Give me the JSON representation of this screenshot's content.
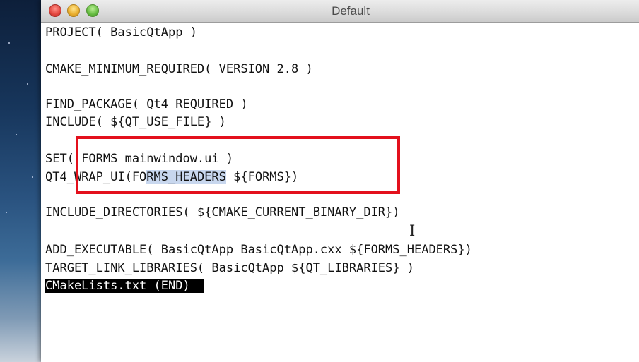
{
  "window": {
    "title": "Default"
  },
  "editor": {
    "lines": [
      "PROJECT( BasicQtApp )",
      "CMAKE_MINIMUM_REQUIRED( VERSION 2.8 )",
      "FIND_PACKAGE( Qt4 REQUIRED )",
      "INCLUDE( ${QT_USE_FILE} )",
      "SET( FORMS mainwindow.ui )",
      "QT4_WRAP_UI(FO",
      "RMS_HEADERS",
      " ${FORMS})",
      "INCLUDE_DIRECTORIES( ${CMAKE_CURRENT_BINARY_DIR})",
      "ADD_EXECUTABLE( BasicQtApp BasicQtApp.cxx ${FORMS_HEADERS})",
      "TARGET_LINK_LIBRARIES( BasicQtApp ${QT_LIBRARIES} )"
    ],
    "status": "CMakeLists.txt (END)"
  },
  "colors": {
    "highlight_box": "#e3101c",
    "selection": "#c8d7ee",
    "status_bg": "#000000"
  },
  "icons": {
    "cursor": "text-cursor-icon"
  }
}
